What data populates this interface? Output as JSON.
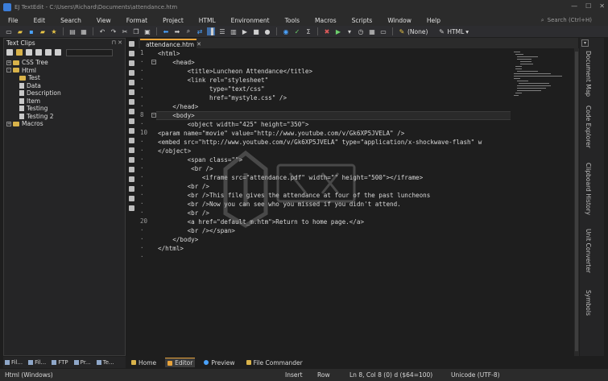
{
  "window": {
    "title": "EJ TextEdit - C:\\Users\\Richard\\Documents\\attendance.htm"
  },
  "menu": [
    "File",
    "Edit",
    "Search",
    "View",
    "Format",
    "Project",
    "HTML",
    "Environment",
    "Tools",
    "Macros",
    "Scripts",
    "Window",
    "Help"
  ],
  "search": {
    "placeholder": "Search (Ctrl+H)"
  },
  "toolbar": {
    "pen_label": "(None)",
    "lang_label": "HTML"
  },
  "left_panel": {
    "title": "Text Clips",
    "tree": [
      {
        "label": "CSS Tree",
        "level": 0,
        "type": "folder",
        "expand": "+"
      },
      {
        "label": "Html",
        "level": 0,
        "type": "folder",
        "expand": "-"
      },
      {
        "label": "Test",
        "level": 1,
        "type": "folder",
        "expand": ""
      },
      {
        "label": "Data",
        "level": 1,
        "type": "doc",
        "expand": ""
      },
      {
        "label": "Description",
        "level": 1,
        "type": "doc",
        "expand": ""
      },
      {
        "label": "Item",
        "level": 1,
        "type": "doc",
        "expand": ""
      },
      {
        "label": "Testing",
        "level": 1,
        "type": "doc",
        "expand": ""
      },
      {
        "label": "Testing 2",
        "level": 1,
        "type": "doc",
        "expand": ""
      },
      {
        "label": "Macros",
        "level": 0,
        "type": "folder",
        "expand": "+"
      }
    ]
  },
  "editor": {
    "tab_label": "attendance.htm",
    "line_numbers": {
      "1": "1",
      "8": "8",
      "10": "10",
      "20": "20"
    },
    "lines": [
      "<html>",
      "    <head>",
      "        <title>Luncheon Attendance</title>",
      "        <link rel=\"stylesheet\"",
      "              type=\"text/css\"",
      "              href=\"mystyle.css\" />",
      "    </head>",
      "    <body>",
      "        <object width=\"425\" height=\"350\">",
      "<param name=\"movie\" value=\"http://www.youtube.com/v/Gk6XP5JVELA\" />",
      "<embed src=\"http://www.youtube.com/v/Gk6XP5JVELA\" type=\"application/x-shockwave-flash\" w",
      "</object>",
      "        <span class=\"\">",
      "         <br />",
      "            <iframe src=\"attendance.pdf\" width=\"\" height=\"500\"></iframe>",
      "        <br />",
      "        <br />This file gives the attendance at four of the past luncheons",
      "        <br />Now you can see who you missed if you didn't attend.",
      "        <br />",
      "        <a href=\"default_m.htm\">Return to home page.</a>",
      "        <br /></span>",
      "    </body>",
      "</html>"
    ]
  },
  "right_panel": [
    "Document Map",
    "Code Explorer",
    "Clipboard History",
    "Unit Converter",
    "Symbols"
  ],
  "bottom_tabs_left": [
    "Fil...",
    "Fil...",
    "FTP",
    "Pr...",
    "Te..."
  ],
  "bottom_tabs_editor": [
    "Home",
    "Editor",
    "Preview",
    "File Commander"
  ],
  "status": {
    "format": "Html (Windows)",
    "insert": "Insert",
    "row": "Row",
    "position": "Ln 8, Col 8 (0) d ($64=100)",
    "encoding": "Unicode (UTF-8)"
  },
  "colors": {
    "accent": "#e8a33a",
    "background": "#1e1e1e",
    "tag_text": "#d9d9d9",
    "attr_text": "#6b6b6b"
  }
}
